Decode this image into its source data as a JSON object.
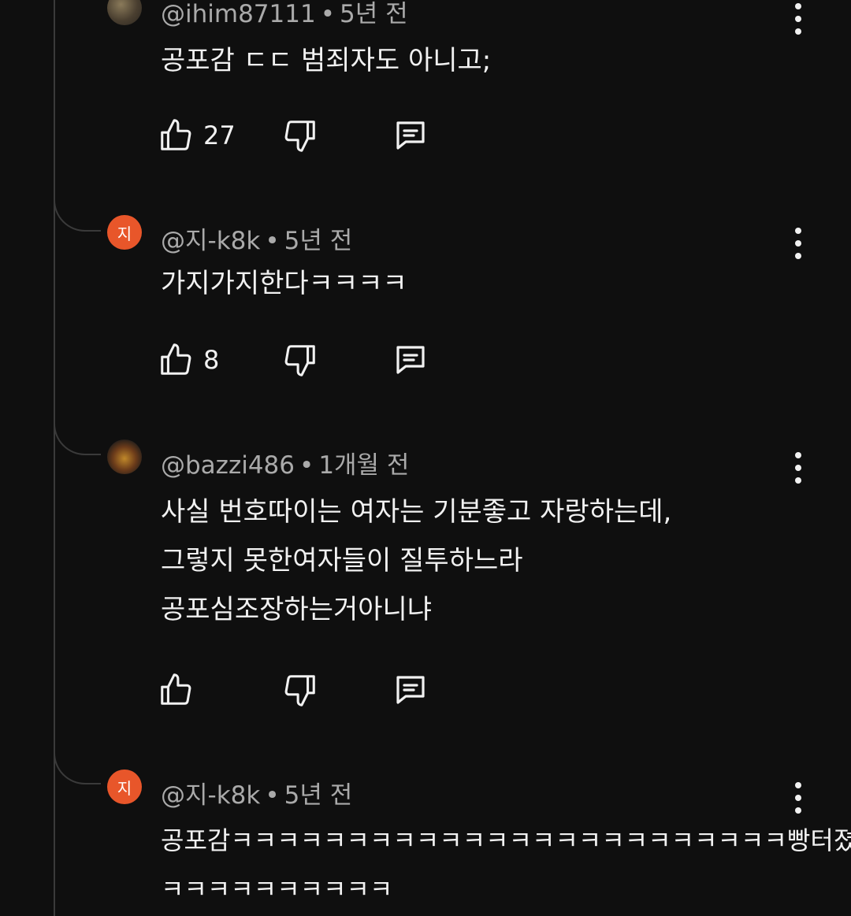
{
  "comments": [
    {
      "handle": "@ihim87111",
      "time": "5년 전",
      "lines": [
        "공포감 ㄷㄷ 범죄자도 아니고;"
      ],
      "likes": "27",
      "avatar": "photo-avatar"
    },
    {
      "handle": "@지-k8k",
      "time": "5년 전",
      "avatar_letter": "지",
      "lines": [
        "가지가지한다ㅋㅋㅋㅋ"
      ],
      "likes": "8"
    },
    {
      "handle": "@bazzi486",
      "time": "1개월 전",
      "lines": [
        "사실 번호따이는 여자는 기분좋고 자랑하는데,",
        "그렇지 못한여자들이 질투하느라",
        "공포심조장하는거아니냐"
      ],
      "likes": "",
      "avatar": "character-avatar"
    },
    {
      "handle": "@지-k8k",
      "time": "5년 전",
      "avatar_letter": "지",
      "lines": [
        "공포감ㅋㅋㅋㅋㅋㅋㅋㅋㅋㅋㅋㅋㅋㅋㅋㅋㅋㅋㅋㅋㅋㅋㅋㅋ빵터졌넼",
        "ㅋㅋㅋㅋㅋㅋㅋㅋㅋㅋ"
      ]
    }
  ],
  "colors": {
    "background": "#0f0f0f",
    "meta": "#aaaaaa",
    "text": "#f1f1f1",
    "avatar_orange": "#e8562a"
  },
  "icons": [
    "like-icon",
    "dislike-icon",
    "reply-icon",
    "more-options-icon"
  ]
}
